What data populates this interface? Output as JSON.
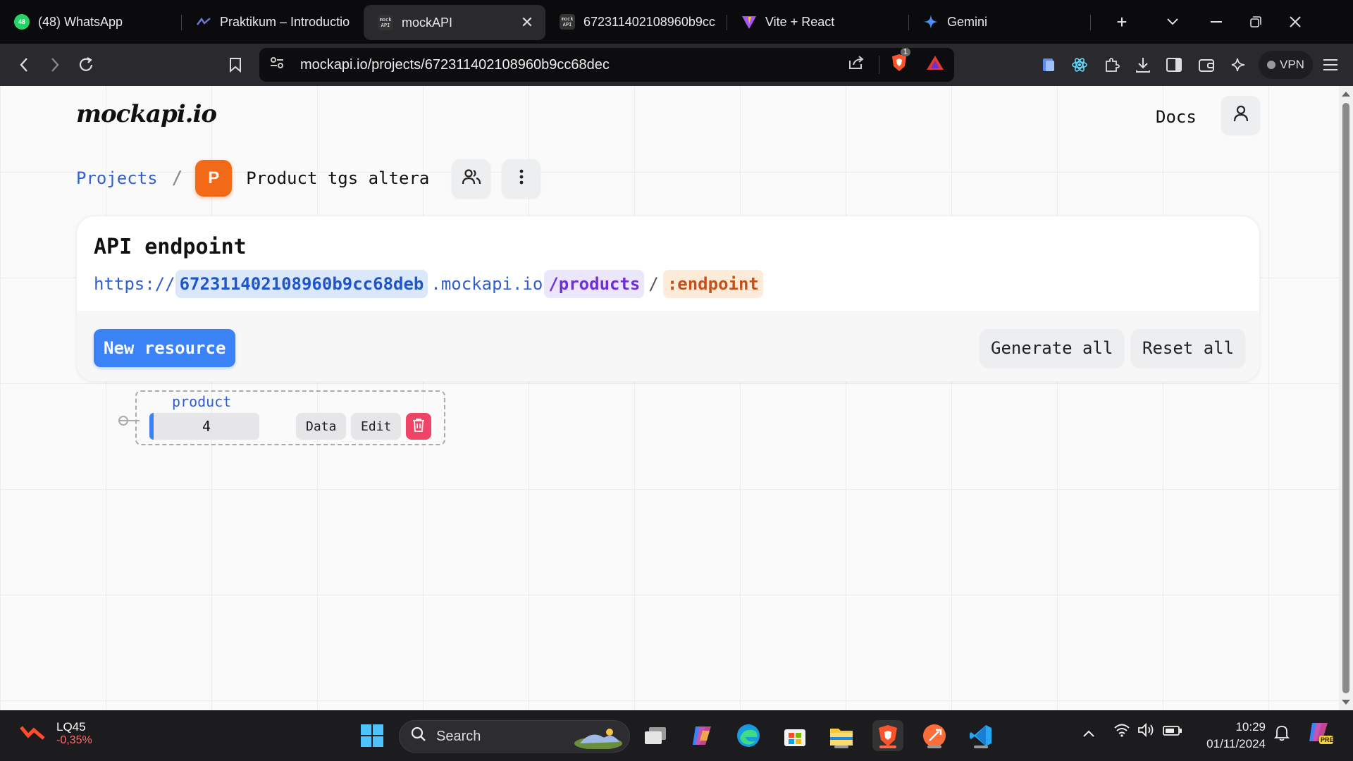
{
  "browser": {
    "tabs": [
      {
        "title": "(48) WhatsApp",
        "favicon": "whatsapp-icon",
        "badge": "48",
        "active": false
      },
      {
        "title": "Praktikum – Introductio",
        "favicon": "praktikum-icon",
        "active": false
      },
      {
        "title": "mockAPI",
        "favicon": "mockapi-icon",
        "active": true
      },
      {
        "title": "672311402108960b9cc",
        "favicon": "mockapi-icon",
        "active": false
      },
      {
        "title": "Vite + React",
        "favicon": "vite-icon",
        "active": false
      },
      {
        "title": "Gemini",
        "favicon": "gemini-icon",
        "active": false
      }
    ],
    "favicon_text": "mock\nAPI",
    "url": "mockapi.io/projects/672311402108960b9cc68dec",
    "brave_badge": "1",
    "vpn_label": "VPN"
  },
  "page": {
    "logo": "mockapi.io",
    "docs_label": "Docs",
    "breadcrumb": {
      "projects_label": "Projects",
      "separator": "/",
      "project_initial": "P",
      "project_name": "Product tgs altera"
    },
    "endpoint_card": {
      "title": "API endpoint",
      "protocol": "https://",
      "project_id": "672311402108960b9cc68deb",
      "domain": ".mockapi.io",
      "resource": "/products",
      "slash": "/",
      "param": ":endpoint"
    },
    "buttons": {
      "new_resource": "New resource",
      "generate_all": "Generate all",
      "reset_all": "Reset all"
    },
    "resource": {
      "name": "product",
      "count": "4",
      "data_label": "Data",
      "edit_label": "Edit"
    }
  },
  "taskbar": {
    "stock_name": "LQ45",
    "stock_change": "-0,35%",
    "search_label": "Search",
    "time": "10:29",
    "date": "01/11/2024",
    "copilot_badge": "PRE"
  },
  "colors": {
    "accent": "#3b82f6",
    "project_badge": "#f26a17",
    "danger": "#ef4465",
    "link": "#2f5fd0"
  }
}
